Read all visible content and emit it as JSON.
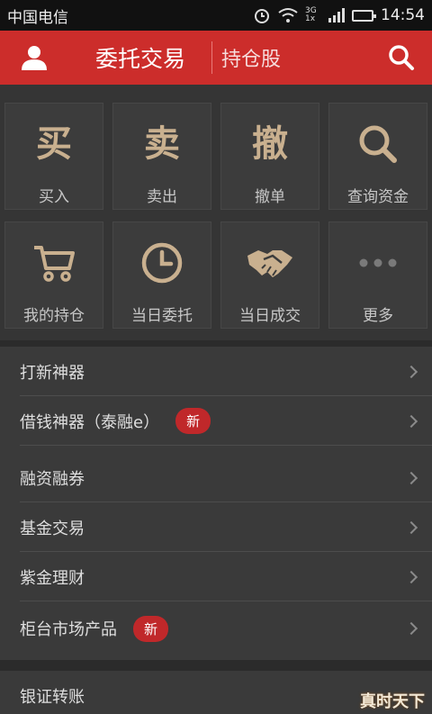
{
  "status_bar": {
    "carrier": "中国电信",
    "network": "3G 1x",
    "time": "14:54"
  },
  "header": {
    "active_tab": "委托交易",
    "tab": "持仓股"
  },
  "tiles": [
    {
      "glyph": "买",
      "label": "买入"
    },
    {
      "glyph": "卖",
      "label": "卖出"
    },
    {
      "glyph": "撤",
      "label": "撤单"
    },
    {
      "icon": "search-icon",
      "label": "查询资金"
    },
    {
      "icon": "cart-icon",
      "label": "我的持仓"
    },
    {
      "icon": "clock-icon",
      "label": "当日委托"
    },
    {
      "icon": "handshake-icon",
      "label": "当日成交"
    },
    {
      "icon": "more-dots-icon",
      "label": "更多"
    }
  ],
  "menu": [
    {
      "label": "打新神器"
    },
    {
      "label": "借钱神器（泰融e）",
      "badge": "新"
    },
    {
      "label": "融资融券"
    },
    {
      "label": "基金交易"
    },
    {
      "label": "紫金理财"
    },
    {
      "label": "柜台市场产品",
      "badge": "新"
    }
  ],
  "menu2": [
    {
      "label": "银证转账"
    }
  ],
  "watermark": "真时天下",
  "colors": {
    "accent": "#cc2d2b",
    "glyph": "#c9b08f",
    "background": "#2b2b2b"
  }
}
